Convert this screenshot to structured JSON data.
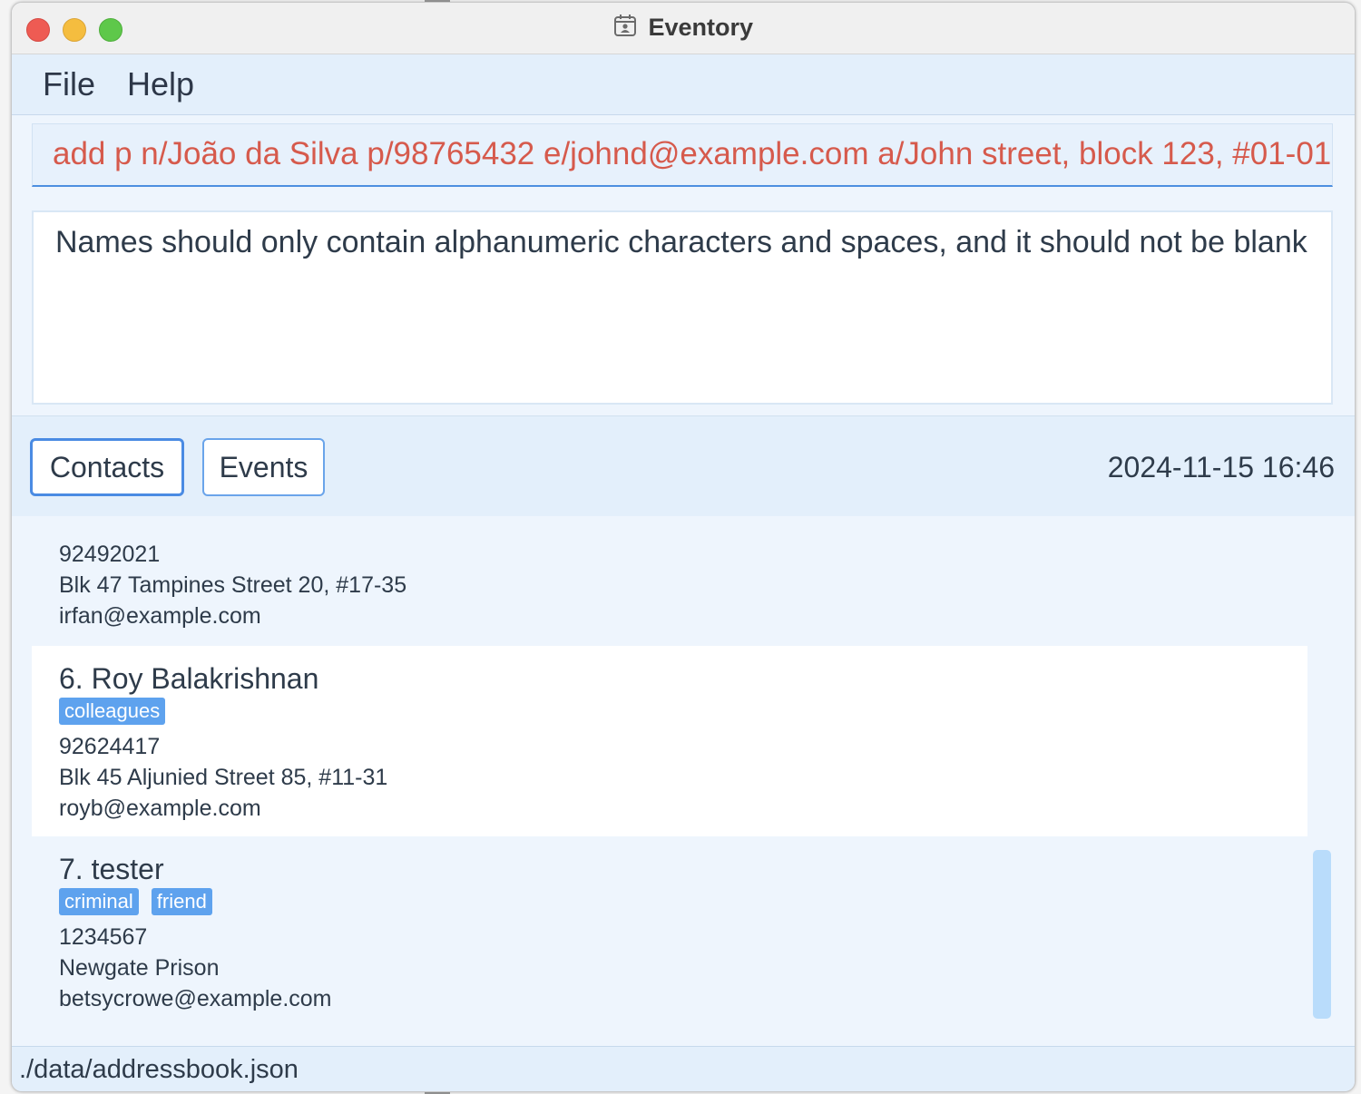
{
  "window": {
    "title": "Eventory",
    "title_icon": "calendar-contact-icon"
  },
  "menu": {
    "items": [
      {
        "label": "File"
      },
      {
        "label": "Help"
      }
    ]
  },
  "command": {
    "value": "add p n/João da Silva p/98765432 e/johnd@example.com a/John street, block 123, #01-01",
    "text_color": "#d65a4c"
  },
  "result": {
    "message": "Names should only contain alphanumeric characters and spaces, and it should not be blank"
  },
  "tabs": {
    "contacts_label": "Contacts",
    "events_label": "Events",
    "selected": "Contacts"
  },
  "datetime": "2024-11-15 16:46",
  "contacts": [
    {
      "phone": "92492021",
      "address": "Blk 47 Tampines Street 20, #17-35",
      "email": "irfan@example.com"
    },
    {
      "index_name": "6. Roy Balakrishnan",
      "tags": [
        "colleagues"
      ],
      "phone": "92624417",
      "address": "Blk 45 Aljunied Street 85, #11-31",
      "email": "royb@example.com"
    },
    {
      "index_name": "7. tester",
      "tags": [
        "criminal",
        "friend"
      ],
      "phone": "1234567",
      "address": "Newgate Prison",
      "email": "betsycrowe@example.com"
    }
  ],
  "status": {
    "file_path": "./data/addressbook.json"
  },
  "colors": {
    "accent": "#4a8be3",
    "tag": "#5ea2ee",
    "error_text": "#d65a4c",
    "panel": "#e3effb"
  }
}
